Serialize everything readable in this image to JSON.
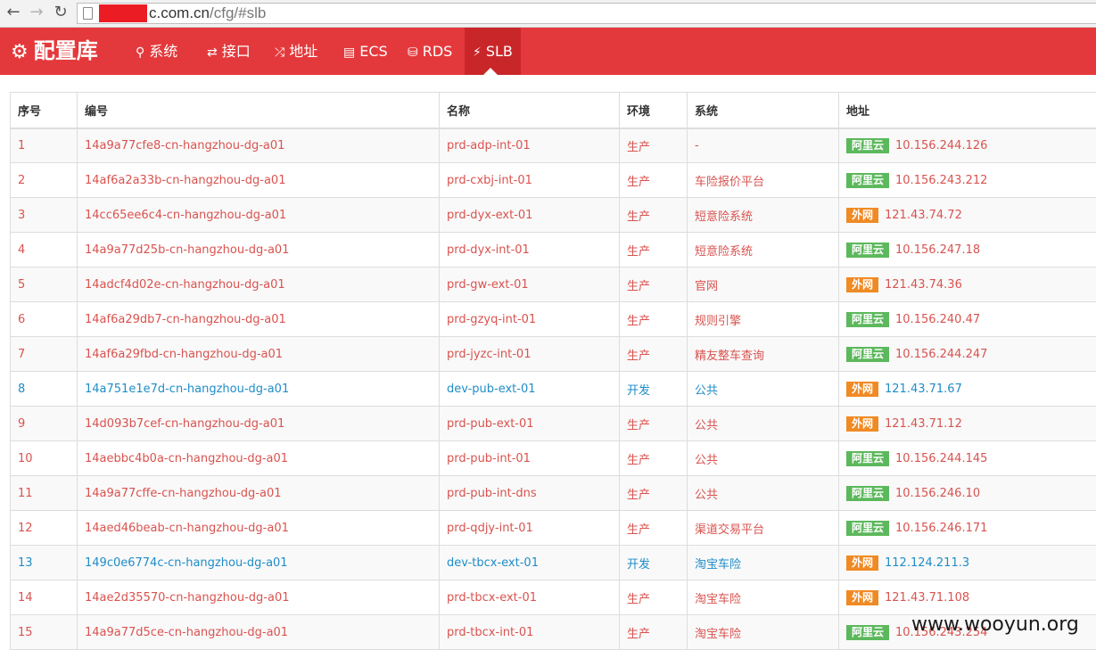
{
  "browser": {
    "url_host": "c.com.cn",
    "url_path": "/cfg/#slb"
  },
  "navbar": {
    "brand": "配置库",
    "items": [
      {
        "key": "system",
        "label": "系统",
        "icon": "key-icon"
      },
      {
        "key": "interface",
        "label": "接口",
        "icon": "exchange-icon"
      },
      {
        "key": "address",
        "label": "地址",
        "icon": "random-icon"
      },
      {
        "key": "ecs",
        "label": "ECS",
        "icon": "server-icon"
      },
      {
        "key": "rds",
        "label": "RDS",
        "icon": "database-icon"
      },
      {
        "key": "slb",
        "label": "SLB",
        "icon": "bolt-icon",
        "active": true
      }
    ]
  },
  "table": {
    "headers": [
      "序号",
      "编号",
      "名称",
      "环境",
      "系统",
      "地址"
    ],
    "rows": [
      {
        "no": "1",
        "id": "14a9a77cfe8-cn-hangzhou-dg-a01",
        "name": "prd-adp-int-01",
        "env": "生产",
        "system": "-",
        "net": "阿里云",
        "ip": "10.156.244.126"
      },
      {
        "no": "2",
        "id": "14af6a2a33b-cn-hangzhou-dg-a01",
        "name": "prd-cxbj-int-01",
        "env": "生产",
        "system": "车险报价平台",
        "net": "阿里云",
        "ip": "10.156.243.212"
      },
      {
        "no": "3",
        "id": "14cc65ee6c4-cn-hangzhou-dg-a01",
        "name": "prd-dyx-ext-01",
        "env": "生产",
        "system": "短意险系统",
        "net": "外网",
        "ip": "121.43.74.72"
      },
      {
        "no": "4",
        "id": "14a9a77d25b-cn-hangzhou-dg-a01",
        "name": "prd-dyx-int-01",
        "env": "生产",
        "system": "短意险系统",
        "net": "阿里云",
        "ip": "10.156.247.18"
      },
      {
        "no": "5",
        "id": "14adcf4d02e-cn-hangzhou-dg-a01",
        "name": "prd-gw-ext-01",
        "env": "生产",
        "system": "官网",
        "net": "外网",
        "ip": "121.43.74.36"
      },
      {
        "no": "6",
        "id": "14af6a29db7-cn-hangzhou-dg-a01",
        "name": "prd-gzyq-int-01",
        "env": "生产",
        "system": "规则引擎",
        "net": "阿里云",
        "ip": "10.156.240.47"
      },
      {
        "no": "7",
        "id": "14af6a29fbd-cn-hangzhou-dg-a01",
        "name": "prd-jyzc-int-01",
        "env": "生产",
        "system": "精友整车查询",
        "net": "阿里云",
        "ip": "10.156.244.247"
      },
      {
        "no": "8",
        "id": "14a751e1e7d-cn-hangzhou-dg-a01",
        "name": "dev-pub-ext-01",
        "env": "开发",
        "system": "公共",
        "net": "外网",
        "ip": "121.43.71.67"
      },
      {
        "no": "9",
        "id": "14d093b7cef-cn-hangzhou-dg-a01",
        "name": "prd-pub-ext-01",
        "env": "生产",
        "system": "公共",
        "net": "外网",
        "ip": "121.43.71.12"
      },
      {
        "no": "10",
        "id": "14aebbc4b0a-cn-hangzhou-dg-a01",
        "name": "prd-pub-int-01",
        "env": "生产",
        "system": "公共",
        "net": "阿里云",
        "ip": "10.156.244.145"
      },
      {
        "no": "11",
        "id": "14a9a77cffe-cn-hangzhou-dg-a01",
        "name": "prd-pub-int-dns",
        "env": "生产",
        "system": "公共",
        "net": "阿里云",
        "ip": "10.156.246.10"
      },
      {
        "no": "12",
        "id": "14aed46beab-cn-hangzhou-dg-a01",
        "name": "prd-qdjy-int-01",
        "env": "生产",
        "system": "渠道交易平台",
        "net": "阿里云",
        "ip": "10.156.246.171"
      },
      {
        "no": "13",
        "id": "149c0e6774c-cn-hangzhou-dg-a01",
        "name": "dev-tbcx-ext-01",
        "env": "开发",
        "system": "淘宝车险",
        "net": "外网",
        "ip": "112.124.211.3"
      },
      {
        "no": "14",
        "id": "14ae2d35570-cn-hangzhou-dg-a01",
        "name": "prd-tbcx-ext-01",
        "env": "生产",
        "system": "淘宝车险",
        "net": "外网",
        "ip": "121.43.71.108"
      },
      {
        "no": "15",
        "id": "14a9a77d5ce-cn-hangzhou-dg-a01",
        "name": "prd-tbcx-int-01",
        "env": "生产",
        "system": "淘宝车险",
        "net": "阿里云",
        "ip": "10.156.243.254"
      }
    ]
  },
  "watermark": "www.wooyun.org",
  "colors": {
    "navbar": "#e4393c",
    "prod_text": "#d9534f",
    "dev_text": "#1f8dc8",
    "badge_cloud": "#5cb85c",
    "badge_external": "#f08a24"
  }
}
